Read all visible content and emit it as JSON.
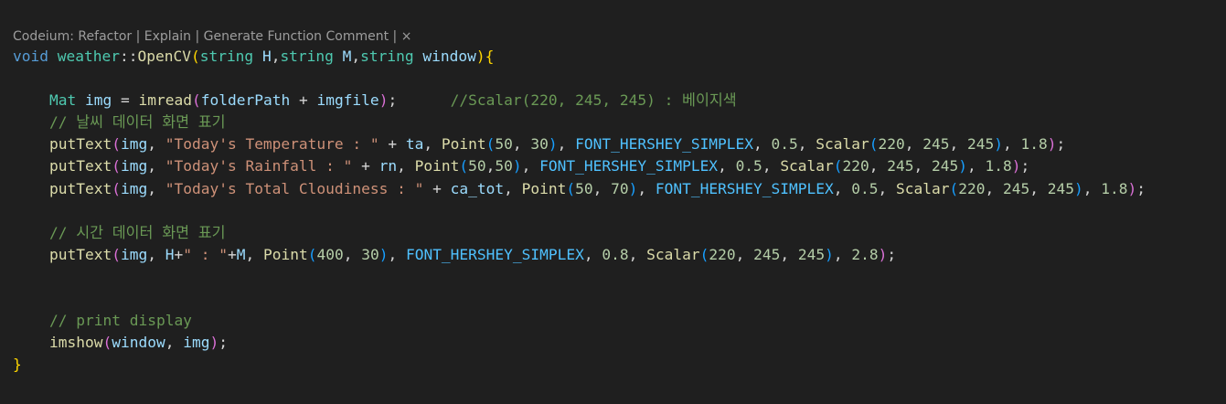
{
  "codelens": {
    "prefix": "Codeium: ",
    "refactor": "Refactor",
    "explain": "Explain",
    "generate": "Generate Function Comment",
    "separator": " | ",
    "close": "×"
  },
  "colors": {
    "background": "#1f1f1f",
    "keyword": "#569cd6",
    "function": "#dcdcaa",
    "type": "#4ec9b0",
    "variable": "#9cdcfe",
    "string": "#ce9178",
    "number": "#b5cea8",
    "comment": "#6a9955",
    "macro": "#4fc1ff",
    "bracket_level1": "#ffd700",
    "bracket_level2": "#da70d6",
    "bracket_level3": "#179fff"
  },
  "lines": [
    {
      "indent": 0,
      "tokens": [
        {
          "t": "kw",
          "v": "void"
        },
        {
          "t": "pu",
          "v": " "
        },
        {
          "t": "ty",
          "v": "weather"
        },
        {
          "t": "pu",
          "v": "::"
        },
        {
          "t": "fn",
          "v": "OpenCV"
        },
        {
          "t": "b1",
          "v": "("
        },
        {
          "t": "ty",
          "v": "string"
        },
        {
          "t": "pu",
          "v": " "
        },
        {
          "t": "var",
          "v": "H"
        },
        {
          "t": "pu",
          "v": ","
        },
        {
          "t": "ty",
          "v": "string"
        },
        {
          "t": "pu",
          "v": " "
        },
        {
          "t": "var",
          "v": "M"
        },
        {
          "t": "pu",
          "v": ","
        },
        {
          "t": "ty",
          "v": "string"
        },
        {
          "t": "pu",
          "v": " "
        },
        {
          "t": "var",
          "v": "window"
        },
        {
          "t": "b1",
          "v": ")"
        },
        {
          "t": "b1",
          "v": "{"
        }
      ]
    },
    {
      "indent": 0,
      "tokens": []
    },
    {
      "indent": 1,
      "tokens": [
        {
          "t": "ty",
          "v": "Mat"
        },
        {
          "t": "pu",
          "v": " "
        },
        {
          "t": "var",
          "v": "img"
        },
        {
          "t": "pu",
          "v": " = "
        },
        {
          "t": "fn",
          "v": "imread"
        },
        {
          "t": "b2",
          "v": "("
        },
        {
          "t": "var",
          "v": "folderPath"
        },
        {
          "t": "pu",
          "v": " + "
        },
        {
          "t": "var",
          "v": "imgfile"
        },
        {
          "t": "b2",
          "v": ")"
        },
        {
          "t": "pu",
          "v": ";      "
        },
        {
          "t": "com",
          "v": "//Scalar(220, 245, 245) : 베이지색"
        }
      ]
    },
    {
      "indent": 1,
      "tokens": [
        {
          "t": "com",
          "v": "// 날씨 데이터 화면 표기"
        }
      ]
    },
    {
      "indent": 1,
      "tokens": [
        {
          "t": "fn",
          "v": "putText"
        },
        {
          "t": "b2",
          "v": "("
        },
        {
          "t": "var",
          "v": "img"
        },
        {
          "t": "pu",
          "v": ", "
        },
        {
          "t": "str",
          "v": "\"Today's Temperature : \""
        },
        {
          "t": "pu",
          "v": " + "
        },
        {
          "t": "var",
          "v": "ta"
        },
        {
          "t": "pu",
          "v": ", "
        },
        {
          "t": "fn",
          "v": "Point"
        },
        {
          "t": "b3",
          "v": "("
        },
        {
          "t": "num",
          "v": "50"
        },
        {
          "t": "pu",
          "v": ", "
        },
        {
          "t": "num",
          "v": "30"
        },
        {
          "t": "b3",
          "v": ")"
        },
        {
          "t": "pu",
          "v": ", "
        },
        {
          "t": "mac",
          "v": "FONT_HERSHEY_SIMPLEX"
        },
        {
          "t": "pu",
          "v": ", "
        },
        {
          "t": "num",
          "v": "0.5"
        },
        {
          "t": "pu",
          "v": ", "
        },
        {
          "t": "fn",
          "v": "Scalar"
        },
        {
          "t": "b3",
          "v": "("
        },
        {
          "t": "num",
          "v": "220"
        },
        {
          "t": "pu",
          "v": ", "
        },
        {
          "t": "num",
          "v": "245"
        },
        {
          "t": "pu",
          "v": ", "
        },
        {
          "t": "num",
          "v": "245"
        },
        {
          "t": "b3",
          "v": ")"
        },
        {
          "t": "pu",
          "v": ", "
        },
        {
          "t": "num",
          "v": "1.8"
        },
        {
          "t": "b2",
          "v": ")"
        },
        {
          "t": "pu",
          "v": ";"
        }
      ]
    },
    {
      "indent": 1,
      "tokens": [
        {
          "t": "fn",
          "v": "putText"
        },
        {
          "t": "b2",
          "v": "("
        },
        {
          "t": "var",
          "v": "img"
        },
        {
          "t": "pu",
          "v": ", "
        },
        {
          "t": "str",
          "v": "\"Today's Rainfall : \""
        },
        {
          "t": "pu",
          "v": " + "
        },
        {
          "t": "var",
          "v": "rn"
        },
        {
          "t": "pu",
          "v": ", "
        },
        {
          "t": "fn",
          "v": "Point"
        },
        {
          "t": "b3",
          "v": "("
        },
        {
          "t": "num",
          "v": "50"
        },
        {
          "t": "pu",
          "v": ","
        },
        {
          "t": "num",
          "v": "50"
        },
        {
          "t": "b3",
          "v": ")"
        },
        {
          "t": "pu",
          "v": ", "
        },
        {
          "t": "mac",
          "v": "FONT_HERSHEY_SIMPLEX"
        },
        {
          "t": "pu",
          "v": ", "
        },
        {
          "t": "num",
          "v": "0.5"
        },
        {
          "t": "pu",
          "v": ", "
        },
        {
          "t": "fn",
          "v": "Scalar"
        },
        {
          "t": "b3",
          "v": "("
        },
        {
          "t": "num",
          "v": "220"
        },
        {
          "t": "pu",
          "v": ", "
        },
        {
          "t": "num",
          "v": "245"
        },
        {
          "t": "pu",
          "v": ", "
        },
        {
          "t": "num",
          "v": "245"
        },
        {
          "t": "b3",
          "v": ")"
        },
        {
          "t": "pu",
          "v": ", "
        },
        {
          "t": "num",
          "v": "1.8"
        },
        {
          "t": "b2",
          "v": ")"
        },
        {
          "t": "pu",
          "v": ";"
        }
      ]
    },
    {
      "indent": 1,
      "tokens": [
        {
          "t": "fn",
          "v": "putText"
        },
        {
          "t": "b2",
          "v": "("
        },
        {
          "t": "var",
          "v": "img"
        },
        {
          "t": "pu",
          "v": ", "
        },
        {
          "t": "str",
          "v": "\"Today's Total Cloudiness : \""
        },
        {
          "t": "pu",
          "v": " + "
        },
        {
          "t": "var",
          "v": "ca_tot"
        },
        {
          "t": "pu",
          "v": ", "
        },
        {
          "t": "fn",
          "v": "Point"
        },
        {
          "t": "b3",
          "v": "("
        },
        {
          "t": "num",
          "v": "50"
        },
        {
          "t": "pu",
          "v": ", "
        },
        {
          "t": "num",
          "v": "70"
        },
        {
          "t": "b3",
          "v": ")"
        },
        {
          "t": "pu",
          "v": ", "
        },
        {
          "t": "mac",
          "v": "FONT_HERSHEY_SIMPLEX"
        },
        {
          "t": "pu",
          "v": ", "
        },
        {
          "t": "num",
          "v": "0.5"
        },
        {
          "t": "pu",
          "v": ", "
        },
        {
          "t": "fn",
          "v": "Scalar"
        },
        {
          "t": "b3",
          "v": "("
        },
        {
          "t": "num",
          "v": "220"
        },
        {
          "t": "pu",
          "v": ", "
        },
        {
          "t": "num",
          "v": "245"
        },
        {
          "t": "pu",
          "v": ", "
        },
        {
          "t": "num",
          "v": "245"
        },
        {
          "t": "b3",
          "v": ")"
        },
        {
          "t": "pu",
          "v": ", "
        },
        {
          "t": "num",
          "v": "1.8"
        },
        {
          "t": "b2",
          "v": ")"
        },
        {
          "t": "pu",
          "v": ";"
        }
      ]
    },
    {
      "indent": 0,
      "tokens": []
    },
    {
      "indent": 1,
      "tokens": [
        {
          "t": "com",
          "v": "// 시간 데이터 화면 표기"
        }
      ]
    },
    {
      "indent": 1,
      "tokens": [
        {
          "t": "fn",
          "v": "putText"
        },
        {
          "t": "b2",
          "v": "("
        },
        {
          "t": "var",
          "v": "img"
        },
        {
          "t": "pu",
          "v": ", "
        },
        {
          "t": "var",
          "v": "H"
        },
        {
          "t": "pu",
          "v": "+"
        },
        {
          "t": "str",
          "v": "\" : \""
        },
        {
          "t": "pu",
          "v": "+"
        },
        {
          "t": "var",
          "v": "M"
        },
        {
          "t": "pu",
          "v": ", "
        },
        {
          "t": "fn",
          "v": "Point"
        },
        {
          "t": "b3",
          "v": "("
        },
        {
          "t": "num",
          "v": "400"
        },
        {
          "t": "pu",
          "v": ", "
        },
        {
          "t": "num",
          "v": "30"
        },
        {
          "t": "b3",
          "v": ")"
        },
        {
          "t": "pu",
          "v": ", "
        },
        {
          "t": "mac",
          "v": "FONT_HERSHEY_SIMPLEX"
        },
        {
          "t": "pu",
          "v": ", "
        },
        {
          "t": "num",
          "v": "0.8"
        },
        {
          "t": "pu",
          "v": ", "
        },
        {
          "t": "fn",
          "v": "Scalar"
        },
        {
          "t": "b3",
          "v": "("
        },
        {
          "t": "num",
          "v": "220"
        },
        {
          "t": "pu",
          "v": ", "
        },
        {
          "t": "num",
          "v": "245"
        },
        {
          "t": "pu",
          "v": ", "
        },
        {
          "t": "num",
          "v": "245"
        },
        {
          "t": "b3",
          "v": ")"
        },
        {
          "t": "pu",
          "v": ", "
        },
        {
          "t": "num",
          "v": "2.8"
        },
        {
          "t": "b2",
          "v": ")"
        },
        {
          "t": "pu",
          "v": ";"
        }
      ]
    },
    {
      "indent": 0,
      "tokens": []
    },
    {
      "indent": 0,
      "tokens": []
    },
    {
      "indent": 1,
      "tokens": [
        {
          "t": "com",
          "v": "// print display"
        }
      ]
    },
    {
      "indent": 1,
      "tokens": [
        {
          "t": "fn",
          "v": "imshow"
        },
        {
          "t": "b2",
          "v": "("
        },
        {
          "t": "var",
          "v": "window"
        },
        {
          "t": "pu",
          "v": ", "
        },
        {
          "t": "var",
          "v": "img"
        },
        {
          "t": "b2",
          "v": ")"
        },
        {
          "t": "pu",
          "v": ";"
        }
      ]
    },
    {
      "indent": 0,
      "tokens": [
        {
          "t": "b1",
          "v": "}"
        }
      ]
    }
  ]
}
